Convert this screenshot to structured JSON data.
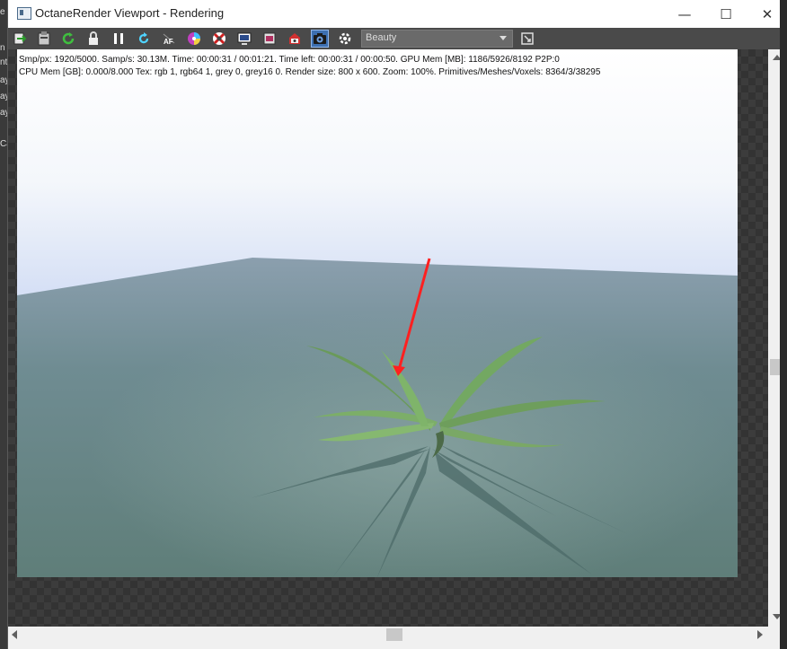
{
  "window": {
    "title": "OctaneRender Viewport - Rendering",
    "minimize_glyph": "—",
    "maximize_glyph": "☐",
    "close_glyph": "✕"
  },
  "background_fragments": [
    "e",
    "n",
    "nt",
    "ay",
    "ay",
    "ay",
    "Ca"
  ],
  "toolbar": {
    "icons": [
      "export-icon",
      "clipboard-icon",
      "restart-icon",
      "lock-icon",
      "pause-icon",
      "reset-icon",
      "af-icon",
      "color-icon",
      "picker-icon",
      "display-icon",
      "film-icon",
      "settings-icon",
      "camera-icon",
      "gear-icon",
      "fit-icon"
    ],
    "af_label": "AF",
    "pass_selected": "Beauty"
  },
  "stats": {
    "line1": "Smp/px: 1920/5000.   Samp/s: 30.13M.   Time: 00:00:31 / 00:01:21.   Time left: 00:00:31 / 00:00:50.   GPU Mem [MB]: 1186/5926/8192 P2P:0",
    "line2": "CPU Mem [GB]: 0.000/8.000   Tex: rgb 1, rgb64 1, grey 0, grey16 0.   Render size: 800 x 600.   Zoom: 100%.   Primitives/Meshes/Voxels: 8364/3/38295"
  },
  "colors": {
    "arrow": "#ff2020",
    "plant": "#7eb36a",
    "toolbar_bg": "#4a4a4a",
    "camera_active": "#3d6fb0"
  }
}
